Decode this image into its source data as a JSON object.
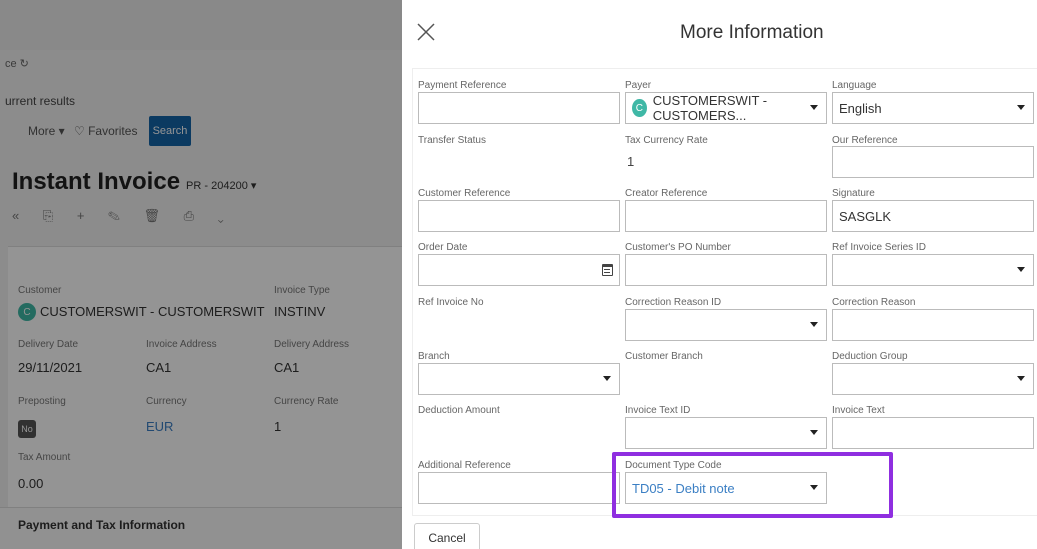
{
  "background": {
    "refresh_text": "ce ↻",
    "results_text": "urrent results",
    "more_label": "More ▾",
    "favorites_label": "♡ Favorites",
    "search_label": "Search",
    "page_title": "Instant Invoice",
    "page_subtitle": "PR - 204200 ▾",
    "toolbar_icons": "« ⎘ + ✎ 🗑 ⎙ ⌄",
    "customer_label": "Customer",
    "customer_avatar": "C",
    "customer_value": "CUSTOMERSWIT - CUSTOMERSWIT",
    "invoice_type_label": "Invoice Type",
    "invoice_type_value": "INSTINV",
    "delivery_date_label": "Delivery Date",
    "delivery_date_value": "29/11/2021",
    "invoice_address_label": "Invoice Address",
    "invoice_address_value": "CA1",
    "delivery_address_label": "Delivery Address",
    "delivery_address_value": "CA1",
    "preposting_label": "Preposting",
    "preposting_value": "No",
    "currency_label": "Currency",
    "currency_value": "EUR",
    "currency_rate_label": "Currency Rate",
    "currency_rate_value": "1",
    "tax_amount_label": "Tax Amount",
    "tax_amount_value": "0.00",
    "section_title": "Payment and Tax Information"
  },
  "dialog": {
    "title": "More Information",
    "cancel_label": "Cancel",
    "fields": {
      "payment_reference": {
        "label": "Payment Reference",
        "value": ""
      },
      "payer": {
        "label": "Payer",
        "avatar": "C",
        "value": "CUSTOMERSWIT - CUSTOMERS..."
      },
      "language": {
        "label": "Language",
        "value": "English"
      },
      "transfer_status": {
        "label": "Transfer Status",
        "value": ""
      },
      "tax_currency_rate": {
        "label": "Tax Currency Rate",
        "value": "1"
      },
      "our_reference": {
        "label": "Our Reference",
        "value": ""
      },
      "customer_reference": {
        "label": "Customer Reference",
        "value": ""
      },
      "creator_reference": {
        "label": "Creator Reference",
        "value": ""
      },
      "signature": {
        "label": "Signature",
        "value": "SASGLK"
      },
      "order_date": {
        "label": "Order Date",
        "value": ""
      },
      "customers_po_number": {
        "label": "Customer's PO Number",
        "value": ""
      },
      "ref_invoice_series_id": {
        "label": "Ref Invoice Series ID",
        "value": ""
      },
      "ref_invoice_no": {
        "label": "Ref Invoice No",
        "value": ""
      },
      "correction_reason_id": {
        "label": "Correction Reason ID",
        "value": ""
      },
      "correction_reason": {
        "label": "Correction Reason",
        "value": ""
      },
      "branch": {
        "label": "Branch",
        "value": ""
      },
      "customer_branch": {
        "label": "Customer Branch",
        "value": ""
      },
      "deduction_group": {
        "label": "Deduction Group",
        "value": ""
      },
      "deduction_amount": {
        "label": "Deduction Amount",
        "value": ""
      },
      "invoice_text_id": {
        "label": "Invoice Text ID",
        "value": ""
      },
      "invoice_text": {
        "label": "Invoice Text",
        "value": ""
      },
      "additional_reference": {
        "label": "Additional Reference",
        "value": ""
      },
      "document_type_code": {
        "label": "Document Type Code",
        "value": "TD05 - Debit note"
      }
    }
  },
  "colors": {
    "accent": "#1464a8",
    "link": "#3b7fc4",
    "highlight": "#8f2ee0",
    "avatar": "#3fb8a6"
  }
}
